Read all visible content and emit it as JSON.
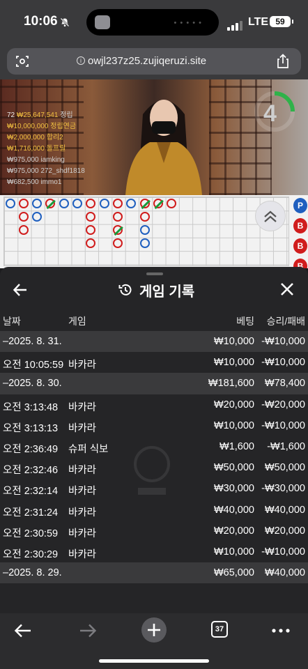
{
  "status_bar": {
    "time": "10:06",
    "network": "LTE",
    "battery": "59"
  },
  "browser": {
    "url": "owjl237z25.zujiqeruzi.site",
    "tab_count": "37"
  },
  "video": {
    "countdown": "4",
    "player_count": "72",
    "total_bet": "₩25,647,541",
    "total_suffix": "정립",
    "leaders": [
      {
        "amount": "₩10,000,000",
        "name": "정립연금",
        "highlight": true
      },
      {
        "amount": "₩2,000,000",
        "name": "합리2",
        "highlight": true
      },
      {
        "amount": "₩1,716,000",
        "name": "돌프릴",
        "highlight": true
      },
      {
        "amount": "₩975,000",
        "name": "iamking",
        "highlight": false
      },
      {
        "amount": "₩975,000",
        "name": "272_shdf1818",
        "highlight": false
      },
      {
        "amount": "₩682,500",
        "name": "immo1",
        "highlight": false
      }
    ]
  },
  "roadmap": {
    "side_labels": [
      "P",
      "B",
      "B",
      "B"
    ],
    "colors": {
      "banker": "#d01c1c",
      "player": "#1f5fbf",
      "tie": "#1a9a3a"
    },
    "columns": [
      [
        "P"
      ],
      [
        "B",
        "B",
        "B"
      ],
      [
        "P",
        "P"
      ],
      [
        "T"
      ],
      [
        "P"
      ],
      [
        "P"
      ],
      [
        "B",
        "B",
        "B",
        "B"
      ],
      [
        "P"
      ],
      [
        "B",
        "B",
        "T",
        "B"
      ],
      [
        "P"
      ],
      [
        "T",
        "B",
        "P",
        "P"
      ],
      [
        "T"
      ],
      [
        "B"
      ]
    ]
  },
  "sheet": {
    "title": "게임 기록",
    "columns": {
      "date": "날짜",
      "game": "게임",
      "bet": "베팅",
      "result": "승리/패배"
    },
    "rows": [
      {
        "type": "date",
        "date": "–2025. 8. 31.",
        "game": "",
        "bet": "₩10,000",
        "result": "-₩10,000"
      },
      {
        "type": "item",
        "date": "오전 10:05:59",
        "game": "바카라",
        "bet": "₩10,000",
        "result": "-₩10,000"
      },
      {
        "type": "date",
        "date": "–2025. 8. 30.",
        "game": "",
        "bet": "₩181,600",
        "result": "₩78,400"
      },
      {
        "type": "item",
        "date": "오전 3:13:48",
        "game": "바카라",
        "bet": "₩20,000",
        "result": "-₩20,000"
      },
      {
        "type": "item",
        "date": "오전 3:13:13",
        "game": "바카라",
        "bet": "₩10,000",
        "result": "-₩10,000"
      },
      {
        "type": "item",
        "date": "오전 2:36:49",
        "game": "슈퍼 식보",
        "bet": "₩1,600",
        "result": "-₩1,600"
      },
      {
        "type": "item",
        "date": "오전 2:32:46",
        "game": "바카라",
        "bet": "₩50,000",
        "result": "₩50,000"
      },
      {
        "type": "item",
        "date": "오전 2:32:14",
        "game": "바카라",
        "bet": "₩30,000",
        "result": "-₩30,000"
      },
      {
        "type": "item",
        "date": "오전 2:31:24",
        "game": "바카라",
        "bet": "₩40,000",
        "result": "₩40,000"
      },
      {
        "type": "item",
        "date": "오전 2:30:59",
        "game": "바카라",
        "bet": "₩20,000",
        "result": "₩20,000"
      },
      {
        "type": "item",
        "date": "오전 2:30:29",
        "game": "바카라",
        "bet": "₩10,000",
        "result": "-₩10,000"
      },
      {
        "type": "date",
        "date": "–2025. 8. 29.",
        "game": "",
        "bet": "₩65,000",
        "result": "₩40,000"
      }
    ]
  }
}
